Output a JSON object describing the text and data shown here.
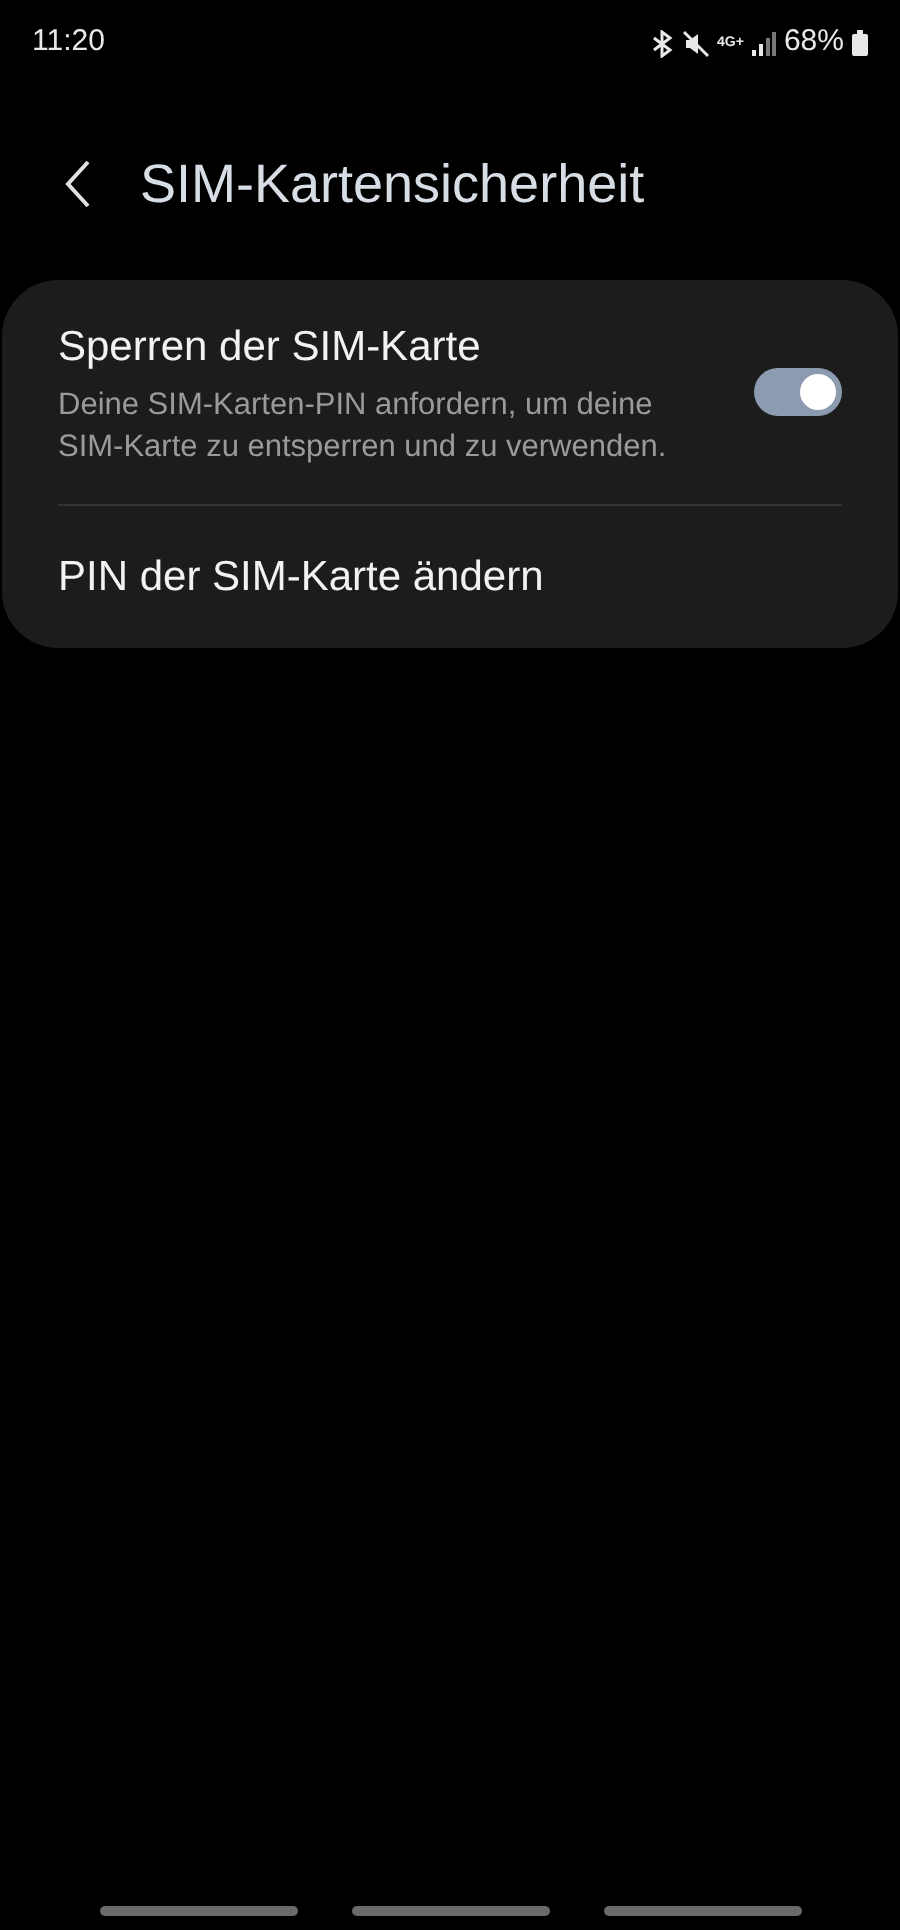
{
  "status_bar": {
    "time": "11:20",
    "network": "4G+",
    "battery": "68%"
  },
  "header": {
    "title": "SIM-Kartensicherheit"
  },
  "items": [
    {
      "kind": "switch",
      "title": "Sperren der SIM-Karte",
      "description": "Deine SIM-Karten-PIN anfordern, um deine SIM-Karte zu entsperren und zu verwenden.",
      "on": true
    },
    {
      "kind": "link",
      "title": "PIN der SIM-Karte ändern"
    }
  ]
}
